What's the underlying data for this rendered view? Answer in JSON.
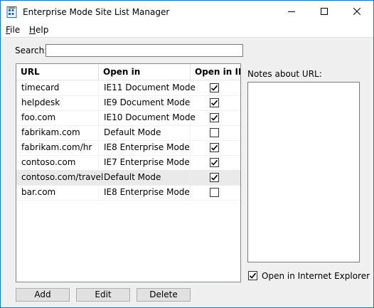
{
  "window": {
    "title": "Enterprise Mode Site List Manager",
    "icon": "app-icon",
    "controls": [
      "minimize-icon",
      "maximize-icon",
      "close-icon"
    ]
  },
  "menu": {
    "file": {
      "accel": "F",
      "rest": "ile"
    },
    "help": {
      "accel": "H",
      "rest": "elp"
    }
  },
  "search": {
    "label": "Search:",
    "value": ""
  },
  "table": {
    "columns": [
      "URL",
      "Open in",
      "Open in IE"
    ],
    "rows": [
      {
        "url": "timecard",
        "open_in": "IE11 Document Mode",
        "open_in_ie": true
      },
      {
        "url": "helpdesk",
        "open_in": "IE9 Document Mode",
        "open_in_ie": true
      },
      {
        "url": "foo.com",
        "open_in": "IE10 Document Mode",
        "open_in_ie": true
      },
      {
        "url": "fabrikam.com",
        "open_in": "Default Mode",
        "open_in_ie": false
      },
      {
        "url": "fabrikam.com/hr",
        "open_in": "IE8 Enterprise Mode",
        "open_in_ie": true
      },
      {
        "url": "contoso.com",
        "open_in": "IE7 Enterprise Mode",
        "open_in_ie": true
      },
      {
        "url": "contoso.com/travel",
        "open_in": "Default Mode",
        "open_in_ie": true,
        "selected": true
      },
      {
        "url": "bar.com",
        "open_in": "IE8 Enterprise Mode",
        "open_in_ie": false
      }
    ]
  },
  "notes": {
    "label": "Notes about URL:",
    "value": ""
  },
  "open_in_ie": {
    "label": "Open in Internet Explorer",
    "checked": true
  },
  "buttons": {
    "add": "Add",
    "edit": "Edit",
    "delete": "Delete"
  },
  "colors": {
    "window_border": "#1979ca",
    "dialog_bg": "#f0f0f0",
    "selected_row": "#eaeaea",
    "button_bg": "#e1e1e1"
  }
}
